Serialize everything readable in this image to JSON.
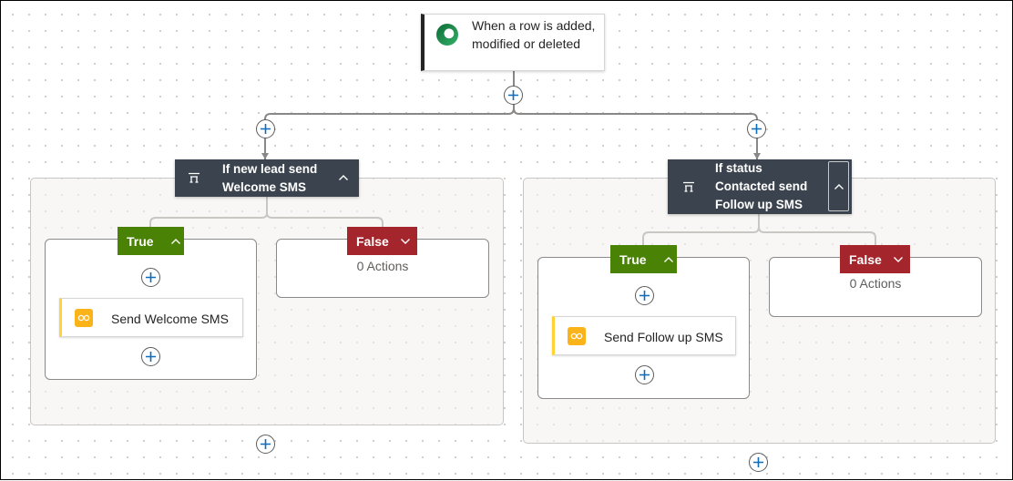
{
  "colors": {
    "true_branch": "#498205",
    "false_branch": "#a4262c",
    "condition_header": "#3b444e",
    "add_button_plus": "#0f6cbd",
    "action_accent": "#fbb31a",
    "trigger_icon": "#1e8a4c"
  },
  "trigger": {
    "label": "When a row is added, modified or deleted",
    "icon": "dataverse-icon"
  },
  "conditions": [
    {
      "title": "If new lead send Welcome SMS",
      "icon": "condition-icon",
      "collapse_icon": "chevron-up-icon",
      "true_branch": {
        "label": "True",
        "actions": [
          {
            "label": "Send Welcome SMS",
            "icon": "sms-connector-icon"
          }
        ]
      },
      "false_branch": {
        "label": "False",
        "empty_text": "0 Actions"
      }
    },
    {
      "title": "If status Contacted send Follow up SMS",
      "icon": "condition-icon",
      "collapse_icon": "chevron-up-icon",
      "true_branch": {
        "label": "True",
        "actions": [
          {
            "label": "Send Follow up SMS",
            "icon": "sms-connector-icon"
          }
        ]
      },
      "false_branch": {
        "label": "False",
        "empty_text": "0 Actions"
      }
    }
  ]
}
